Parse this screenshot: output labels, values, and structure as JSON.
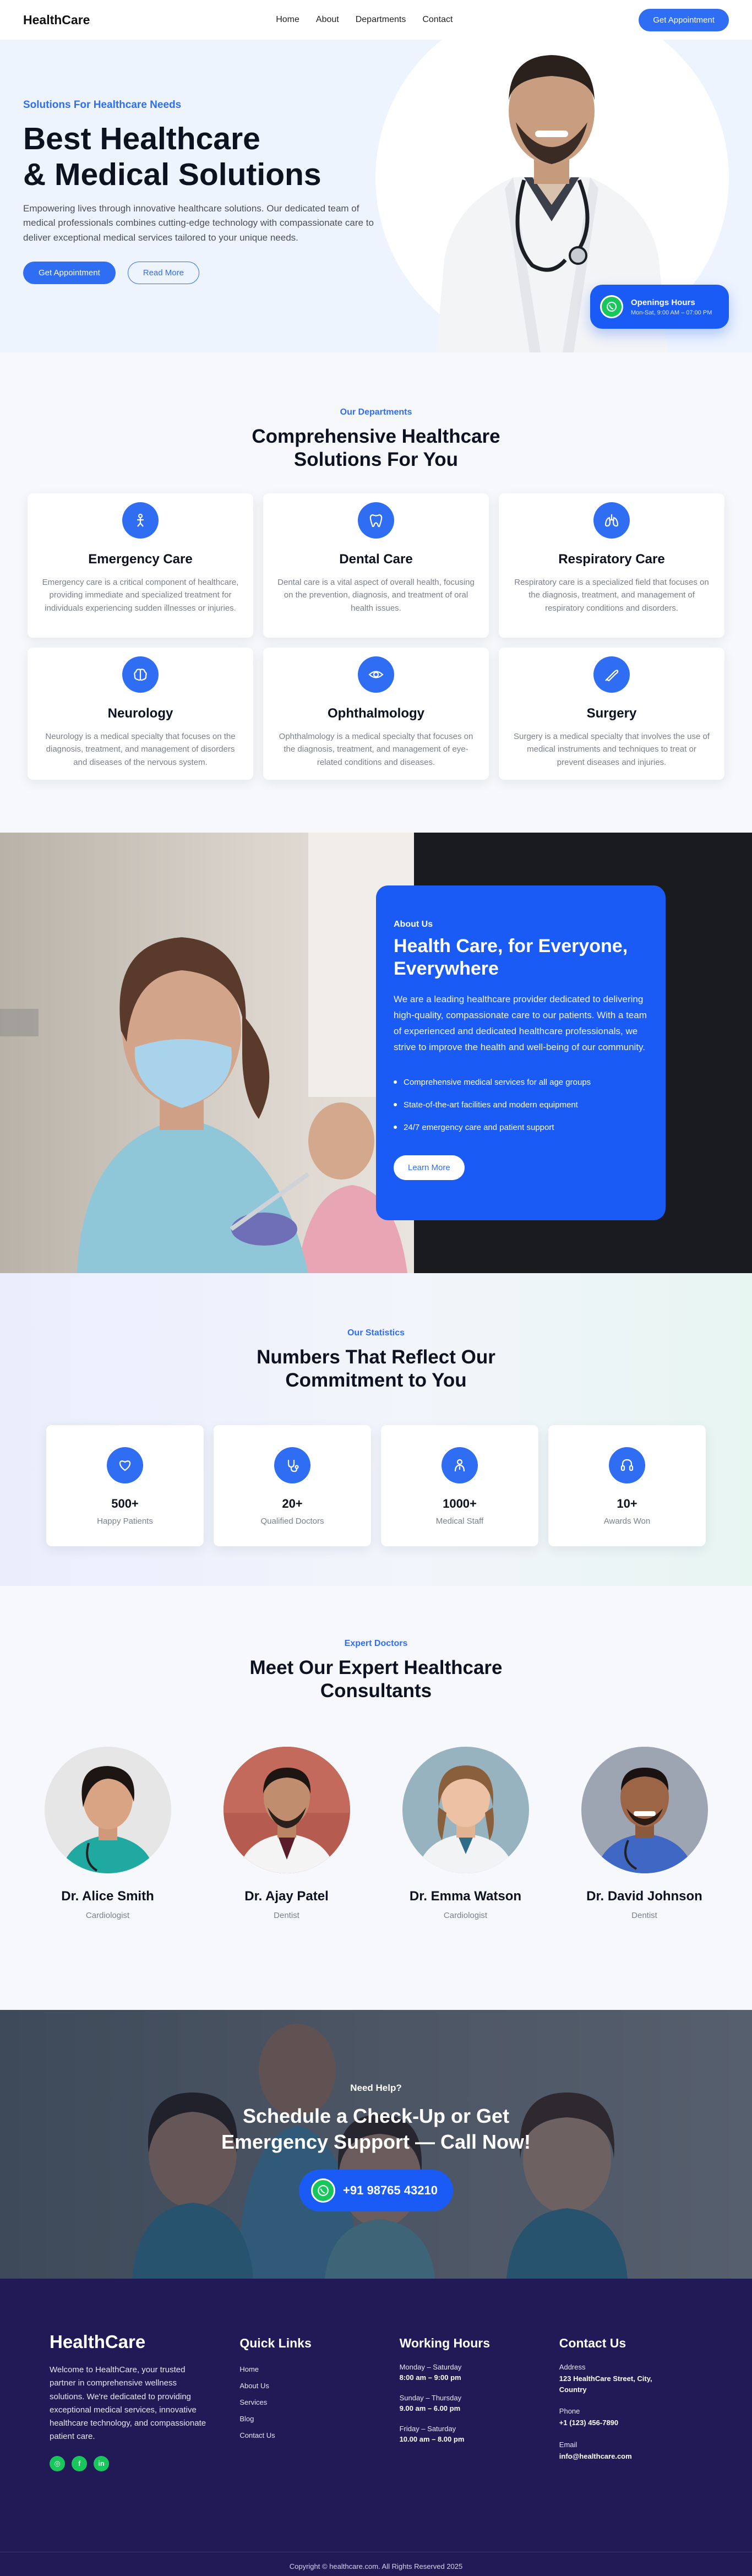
{
  "nav": {
    "logo": "HealthCare",
    "links": [
      "Home",
      "About",
      "Departments",
      "Contact"
    ],
    "cta": "Get Appointment"
  },
  "hero": {
    "kicker": "Solutions For Healthcare Needs",
    "title_line1": "Best Healthcare",
    "title_line2": "& Medical Solutions",
    "description": "Empowering lives through innovative healthcare solutions. Our dedicated team of medical professionals combines cutting-edge technology with compassionate care to deliver exceptional medical services tailored to your unique needs.",
    "primary_button": "Get Appointment",
    "secondary_button": "Read More",
    "hours_title": "Openings Hours",
    "hours_text": "Mon-Sat, 9:00 AM – 07:00 PM"
  },
  "departments": {
    "kicker": "Our Departments",
    "title_line1": "Comprehensive Healthcare",
    "title_line2": "Solutions For You",
    "items": [
      {
        "name": "Emergency Care",
        "desc": "Emergency care is a critical component of healthcare, providing immediate and specialized treatment for individuals experiencing sudden illnesses or injuries.",
        "icon": "emergency-icon"
      },
      {
        "name": "Dental Care",
        "desc": "Dental care is a vital aspect of overall health, focusing on the prevention, diagnosis, and treatment of oral health issues.",
        "icon": "tooth-icon"
      },
      {
        "name": "Respiratory Care",
        "desc": "Respiratory care is a specialized field that focuses on the diagnosis, treatment, and management of respiratory conditions and disorders.",
        "icon": "lungs-icon"
      },
      {
        "name": "Neurology",
        "desc": "Neurology is a medical specialty that focuses on the diagnosis, treatment, and management of disorders and diseases of the nervous system.",
        "icon": "brain-icon"
      },
      {
        "name": "Ophthalmology",
        "desc": "Ophthalmology is a medical specialty that focuses on the diagnosis, treatment, and management of eye-related conditions and diseases.",
        "icon": "eye-icon"
      },
      {
        "name": "Surgery",
        "desc": "Surgery is a medical specialty that involves the use of medical instruments and techniques to treat or prevent diseases and injuries.",
        "icon": "scalpel-icon"
      }
    ]
  },
  "about": {
    "kicker": "About Us",
    "title_line1": "Health Care, for Everyone,",
    "title_line2": "Everywhere",
    "text": "We are a leading healthcare provider dedicated to delivering high-quality, compassionate care to our patients. With a team of experienced and dedicated healthcare professionals, we strive to improve the health and well-being of our community.",
    "points": [
      "Comprehensive medical services for all age groups",
      "State-of-the-art facilities and modern equipment",
      "24/7 emergency care and patient support"
    ],
    "button": "Learn More"
  },
  "stats": {
    "kicker": "Our Statistics",
    "title_line1": "Numbers That Reflect Our",
    "title_line2": "Commitment to You",
    "items": [
      {
        "value": "500+",
        "label": "Happy Patients",
        "icon": "heart-hand-icon"
      },
      {
        "value": "20+",
        "label": "Qualified Doctors",
        "icon": "stethoscope-icon"
      },
      {
        "value": "1000+",
        "label": "Medical Staff",
        "icon": "staff-icon"
      },
      {
        "value": "10+",
        "label": "Awards Won",
        "icon": "award-icon"
      }
    ]
  },
  "team": {
    "kicker": "Expert Doctors",
    "title_line1": "Meet Our Expert Healthcare",
    "title_line2": "Consultants",
    "doctors": [
      {
        "name": "Dr. Alice Smith",
        "role": "Cardiologist"
      },
      {
        "name": "Dr. Ajay Patel",
        "role": "Dentist"
      },
      {
        "name": "Dr. Emma Watson",
        "role": "Cardiologist"
      },
      {
        "name": "Dr. David Johnson",
        "role": "Dentist"
      }
    ]
  },
  "cta": {
    "kicker": "Need Help?",
    "title_line1": "Schedule a Check-Up or Get",
    "title_line2": "Emergency Support — Call Now!",
    "phone": "+91 98765 43210"
  },
  "footer": {
    "logo": "HealthCare",
    "about": "Welcome to HealthCare, your trusted partner in comprehensive wellness solutions. We're dedicated to providing exceptional medical services, innovative healthcare technology, and compassionate patient care.",
    "quick_links_title": "Quick Links",
    "quick_links": [
      "Home",
      "About Us",
      "Services",
      "Blog",
      "Contact Us"
    ],
    "hours_title": "Working Hours",
    "hours": [
      {
        "days": "Monday – Saturday",
        "time": "8:00 am – 9:00 pm"
      },
      {
        "days": "Sunday – Thursday",
        "time": "9.00 am – 6.00 pm"
      },
      {
        "days": "Friday – Saturday",
        "time": "10.00 am – 8.00 pm"
      }
    ],
    "contact_title": "Contact Us",
    "address_label": "Address",
    "address": "123 HealthCare Street, City, Country",
    "phone_label": "Phone",
    "phone": "+1 (123) 456-7890",
    "email_label": "Email",
    "email": "info@healthcare.com",
    "copyright": "Copyright © healthcare.com. All Rights Reserved 2025"
  },
  "colors": {
    "accent": "#2f6ef2",
    "card_blue": "#1a5bf6",
    "green": "#17c75b",
    "footer_bg": "#211a56"
  }
}
